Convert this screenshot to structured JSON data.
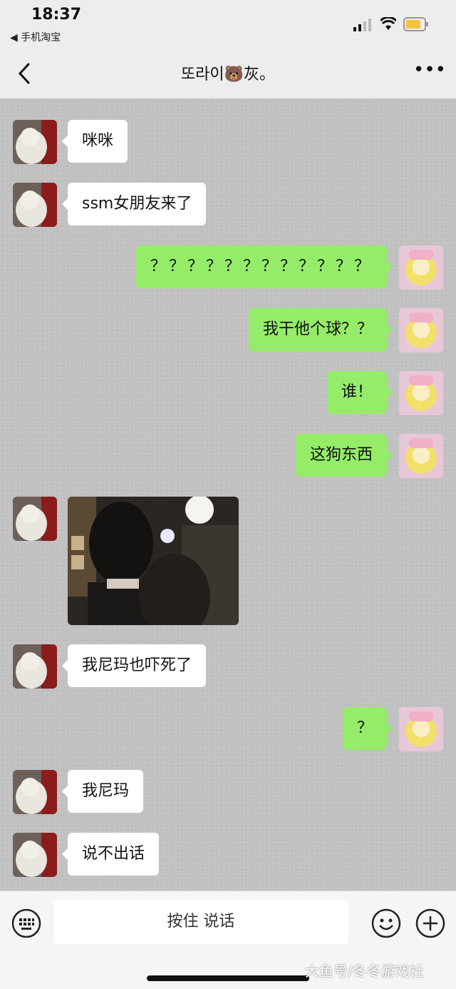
{
  "status_bar": {
    "time": "18:37",
    "back_app": "◀ 手机淘宝"
  },
  "header": {
    "title": "또라이🐻灰。",
    "more": "•••"
  },
  "messages": [
    {
      "side": "left",
      "text": "咪咪"
    },
    {
      "side": "left",
      "text": "ssm女朋友来了"
    },
    {
      "side": "right",
      "text": "？？？？？？？？？？？？"
    },
    {
      "side": "right",
      "text": "我干他个球？？"
    },
    {
      "side": "right",
      "text": "谁！"
    },
    {
      "side": "right",
      "text": "这狗东西"
    },
    {
      "side": "left",
      "type": "image"
    },
    {
      "side": "left",
      "text": "我尼玛也吓死了"
    },
    {
      "side": "right",
      "text": "？"
    },
    {
      "side": "left",
      "text": "我尼玛"
    },
    {
      "side": "left",
      "text": "说不出话"
    }
  ],
  "input_bar": {
    "voice_label": "按住 说话"
  },
  "watermark": "大鱼号/冬冬游戏社",
  "colors": {
    "sent_bubble": "#95ec69",
    "received_bubble": "#ffffff",
    "chat_bg": "#c1c1c1"
  },
  "icons": [
    "signal-icon",
    "wifi-icon",
    "battery-icon",
    "back-chevron-icon",
    "more-icon",
    "keyboard-icon",
    "emoji-icon",
    "plus-icon"
  ]
}
